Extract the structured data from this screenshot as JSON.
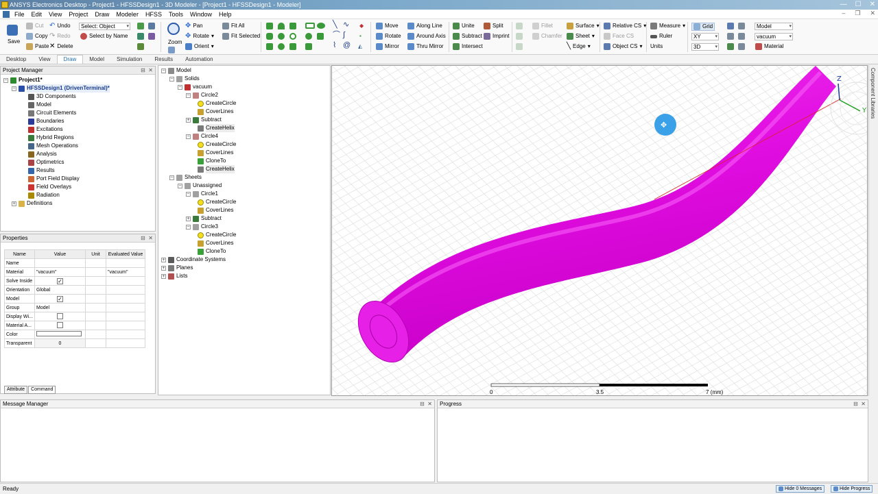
{
  "titlebar": {
    "title": "ANSYS Electronics Desktop - Project1 - HFSSDesign1 - 3D Modeler - [Project1 - HFSSDesign1 - Modeler]"
  },
  "menu": [
    "File",
    "Edit",
    "View",
    "Project",
    "Draw",
    "Modeler",
    "HFSS",
    "Tools",
    "Window",
    "Help"
  ],
  "ribbon": {
    "save": "Save",
    "cut": "Cut",
    "copy": "Copy",
    "paste": "Paste",
    "undo": "Undo",
    "redo": "Redo",
    "delete": "Delete",
    "select_label": "Select: Object",
    "select_by_name": "Select by Name",
    "zoom": "Zoom",
    "pan": "Pan",
    "rotate": "Rotate",
    "orient": "Orient",
    "fit_all": "Fit All",
    "fit_selected": "Fit Selected",
    "move": "Move",
    "rotate2": "Rotate",
    "mirror": "Mirror",
    "along_line": "Along Line",
    "around_axis": "Around Axis",
    "thru_mirror": "Thru Mirror",
    "unite": "Unite",
    "subtract": "Subtract",
    "intersect": "Intersect",
    "split": "Split",
    "imprint": "Imprint",
    "fillet": "Fillet",
    "chamfer": "Chamfer",
    "surface": "Surface",
    "sheet": "Sheet",
    "edge": "Edge",
    "relative_cs": "Relative CS",
    "face_cs": "Face CS",
    "object_cs": "Object CS",
    "measure": "Measure",
    "ruler": "Ruler",
    "units": "Units",
    "grid": "Grid",
    "plane": "XY",
    "dim": "3D",
    "model_combo": "Model",
    "material_combo": "vacuum",
    "material": "Material"
  },
  "tabs": [
    {
      "label": "Desktop"
    },
    {
      "label": "View"
    },
    {
      "label": "Draw"
    },
    {
      "label": "Model"
    },
    {
      "label": "Simulation"
    },
    {
      "label": "Results"
    },
    {
      "label": "Automation"
    }
  ],
  "project_manager": {
    "title": "Project Manager",
    "items": [
      {
        "label": "Project1*",
        "icon": "project-icon",
        "color": "#2e8b2e"
      },
      {
        "label": "HFSSDesign1 (DrivenTerminal)*",
        "icon": "design-icon",
        "color": "#2a4fa8"
      },
      {
        "label": "3D Components",
        "icon": "components-icon",
        "color": "#555555"
      },
      {
        "label": "Model",
        "icon": "model-icon",
        "color": "#666666"
      },
      {
        "label": "Circuit Elements",
        "icon": "circuit-icon",
        "color": "#777777"
      },
      {
        "label": "Boundaries",
        "icon": "boundaries-icon",
        "color": "#2a3b9a"
      },
      {
        "label": "Excitations",
        "icon": "excitations-icon",
        "color": "#c03030"
      },
      {
        "label": "Hybrid Regions",
        "icon": "hybrid-icon",
        "color": "#3a7a3a"
      },
      {
        "label": "Mesh Operations",
        "icon": "mesh-icon",
        "color": "#446688"
      },
      {
        "label": "Analysis",
        "icon": "analysis-icon",
        "color": "#886622"
      },
      {
        "label": "Optimetrics",
        "icon": "optimetrics-icon",
        "color": "#aa4444"
      },
      {
        "label": "Results",
        "icon": "results-icon",
        "color": "#3366aa"
      },
      {
        "label": "Port Field Display",
        "icon": "port-icon",
        "color": "#cc6633"
      },
      {
        "label": "Field Overlays",
        "icon": "overlays-icon",
        "color": "#cc3333"
      },
      {
        "label": "Radiation",
        "icon": "radiation-icon",
        "color": "#aa8800"
      },
      {
        "label": "Definitions",
        "icon": "folder-icon",
        "color": "#d9b34a"
      }
    ]
  },
  "model_tree": {
    "items": [
      {
        "label": "Model"
      },
      {
        "label": "Solids"
      },
      {
        "label": "vacuum"
      },
      {
        "label": "Circle2"
      },
      {
        "label": "CreateCircle"
      },
      {
        "label": "CoverLines"
      },
      {
        "label": "Subtract"
      },
      {
        "label": "CreateHelix"
      },
      {
        "label": "Circle4"
      },
      {
        "label": "CreateCircle"
      },
      {
        "label": "CoverLines"
      },
      {
        "label": "CloneTo"
      },
      {
        "label": "CreateHelix"
      },
      {
        "label": "Sheets"
      },
      {
        "label": "Unassigned"
      },
      {
        "label": "Circle1"
      },
      {
        "label": "CreateCircle"
      },
      {
        "label": "CoverLines"
      },
      {
        "label": "Subtract"
      },
      {
        "label": "Circle3"
      },
      {
        "label": "CreateCircle"
      },
      {
        "label": "CoverLines"
      },
      {
        "label": "CloneTo"
      },
      {
        "label": "Coordinate Systems"
      },
      {
        "label": "Planes"
      },
      {
        "label": "Lists"
      }
    ]
  },
  "properties": {
    "title": "Properties",
    "headers": [
      "Name",
      "Value",
      "Unit",
      "Evaluated Value"
    ],
    "rows": [
      {
        "name": "Name",
        "value": "",
        "unit": "",
        "eval": "",
        "check": false
      },
      {
        "name": "Material",
        "value": "\"vacuum\"",
        "unit": "",
        "eval": "\"vacuum\"",
        "check": false
      },
      {
        "name": "Solve Inside",
        "value": "",
        "unit": "",
        "eval": "",
        "check": true,
        "checked": "✓"
      },
      {
        "name": "Orientation",
        "value": "Global",
        "unit": "",
        "eval": "",
        "check": false
      },
      {
        "name": "Model",
        "value": "",
        "unit": "",
        "eval": "",
        "check": true,
        "checked": "✓"
      },
      {
        "name": "Group",
        "value": "Model",
        "unit": "",
        "eval": "",
        "check": false
      },
      {
        "name": "Display Wi...",
        "value": "",
        "unit": "",
        "eval": "",
        "check": true,
        "checked": ""
      },
      {
        "name": "Material A...",
        "value": "",
        "unit": "",
        "eval": "",
        "check": true,
        "checked": ""
      },
      {
        "name": "Color",
        "value": "",
        "unit": "",
        "eval": "",
        "check": false
      },
      {
        "name": "Transparent",
        "value": "0",
        "unit": "",
        "eval": "",
        "check": false
      }
    ],
    "tabs": [
      "Attribute",
      "Command"
    ]
  },
  "viewport": {
    "scale": [
      "0",
      "3.5",
      "7 (mm)"
    ],
    "axis_z": "Z",
    "axis_y": "Y",
    "object_color": "#e60de6"
  },
  "message_manager": {
    "title": "Message Manager"
  },
  "progress": {
    "title": "Progress"
  },
  "side_library": "Component Libraries",
  "status": {
    "text": "Ready",
    "hide_messages": "Hide 0 Messages",
    "hide_progress": "Hide Progress"
  }
}
